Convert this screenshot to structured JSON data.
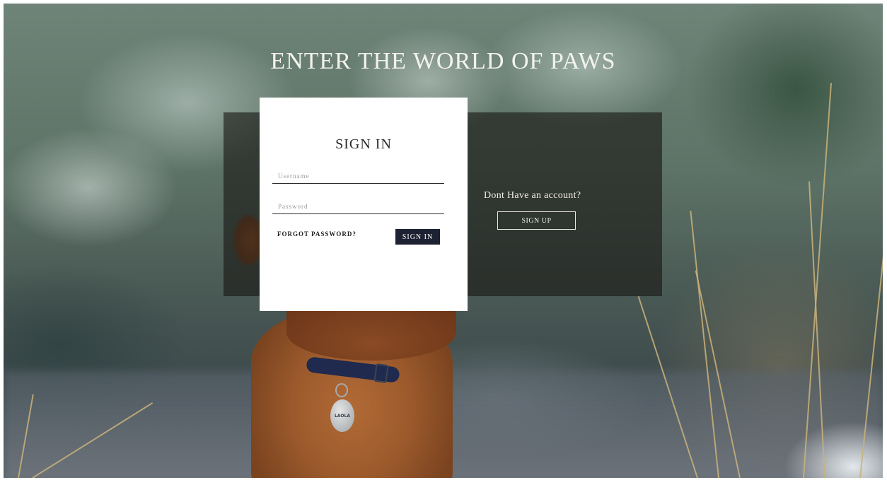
{
  "page": {
    "title": "ENTER THE WORLD OF PAWS"
  },
  "signin": {
    "title": "SIGN IN",
    "username_placeholder": "Username",
    "password_placeholder": "Password",
    "forgot_label": "FORGOT PASSWORD?",
    "submit_label": "SIGN IN"
  },
  "signup": {
    "question": "Dont Have an account?",
    "button_label": "SIGN UP"
  },
  "photo": {
    "tag_text": "LAOLA"
  },
  "colors": {
    "signin_button_bg": "#1d2233",
    "panel_overlay": "rgba(25,22,20,0.62)",
    "card_bg": "#ffffff"
  }
}
